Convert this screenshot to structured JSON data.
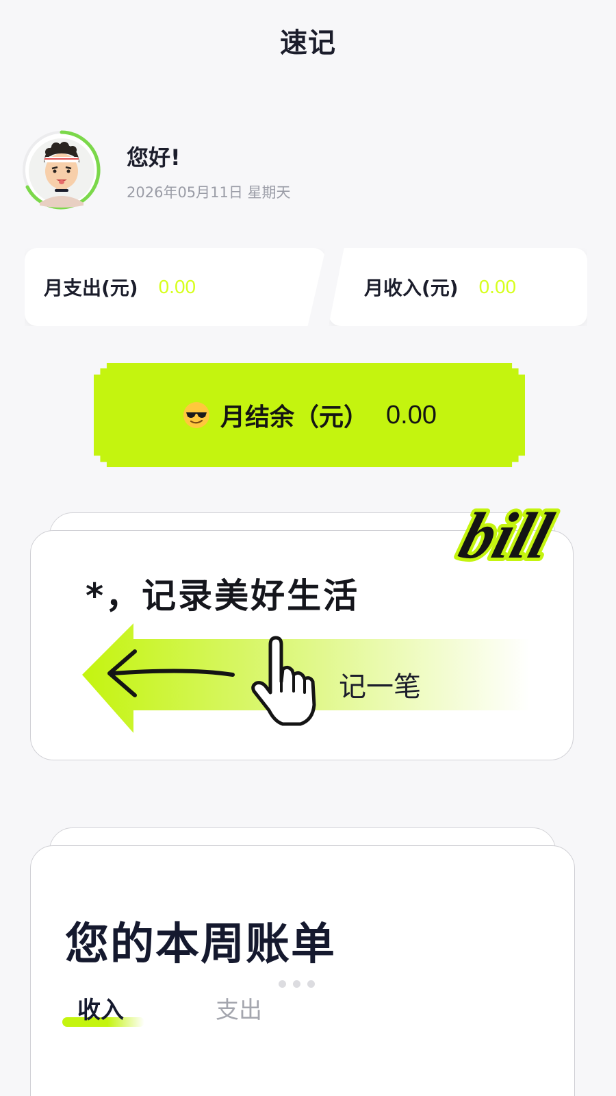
{
  "header": {
    "title": "速记"
  },
  "user": {
    "greeting": "您好!",
    "date": "2026年05月11日  星期天"
  },
  "stats": {
    "expense_label": "月支出(元)",
    "expense_value": "0.00",
    "income_label": "月收入(元)",
    "income_value": "0.00"
  },
  "balance": {
    "label": "月结余（元）",
    "value": "0.00"
  },
  "record_card": {
    "slogan": "*，记录美好生活",
    "action_label": "记一笔",
    "badge_word": "bill"
  },
  "weekly": {
    "title": "您的本周账单",
    "tabs": [
      {
        "label": "收入",
        "active": true
      },
      {
        "label": "支出",
        "active": false
      }
    ],
    "pager_dots": 3
  },
  "colors": {
    "accent": "#c4f40f",
    "value_text": "#d7ff1e",
    "text_dark": "#1b1d2b",
    "muted": "#9a9ca6"
  },
  "icons": [
    "avatar",
    "cool-face-emoji-icon",
    "arrow-left-icon",
    "pointing-hand-icon"
  ]
}
